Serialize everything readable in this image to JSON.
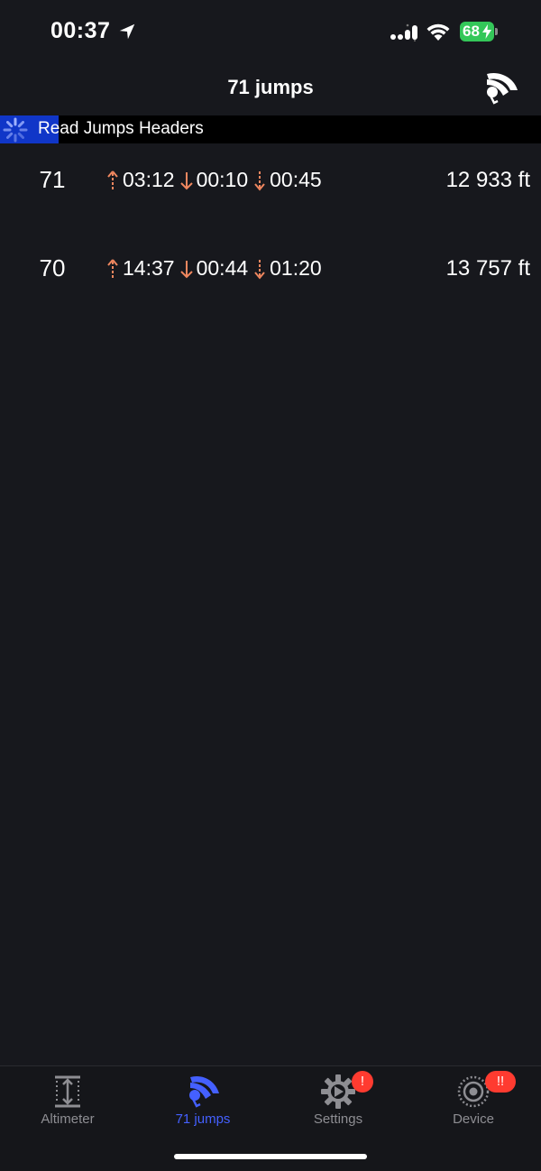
{
  "status_bar": {
    "time": "00:37",
    "battery": "68",
    "colors": {
      "battery": "#34c759"
    }
  },
  "nav": {
    "title": "71 jumps",
    "right_icon": "canopy-icon"
  },
  "progress": {
    "label": "Read Jumps Headers",
    "fraction": 0.108,
    "colors": {
      "fill": "#1036c8",
      "track": "#000000"
    }
  },
  "jumps": [
    {
      "number": "71",
      "climb": "03:12",
      "freefall": "00:10",
      "canopy": "00:45",
      "altitude": "12 933 ft"
    },
    {
      "number": "70",
      "climb": "14:37",
      "freefall": "00:44",
      "canopy": "01:20",
      "altitude": "13 757 ft"
    }
  ],
  "tabs": [
    {
      "label": "Altimeter",
      "icon": "altimeter-icon",
      "badge": ""
    },
    {
      "label": "71 jumps",
      "icon": "canopy-icon",
      "badge": "",
      "active": true
    },
    {
      "label": "Settings",
      "icon": "gear-icon",
      "badge": "!"
    },
    {
      "label": "Device",
      "icon": "device-icon",
      "badge": "!!"
    }
  ],
  "colors": {
    "accent": "#4460ff",
    "arrow": "#f0875f",
    "badge": "#ff3b30",
    "background": "#17181d"
  }
}
